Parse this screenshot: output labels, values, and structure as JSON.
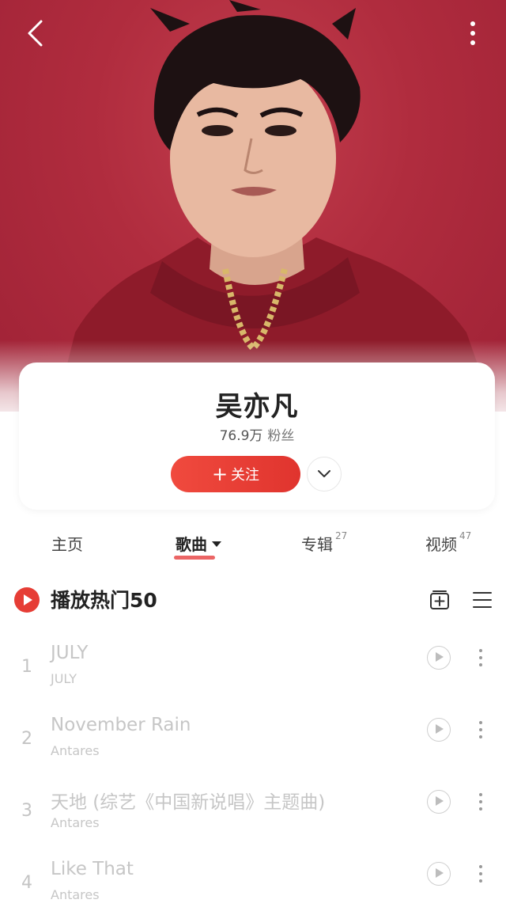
{
  "artist": {
    "name": "吴亦凡",
    "fans_count": "76.9万",
    "fans_label": "粉丝",
    "follow_label": "关注",
    "follow_plus": "+"
  },
  "tabs": [
    {
      "label": "主页",
      "count": ""
    },
    {
      "label": "歌曲",
      "count": ""
    },
    {
      "label": "专辑",
      "count": "27"
    },
    {
      "label": "视频",
      "count": "47"
    }
  ],
  "playall": {
    "label": "播放热门50"
  },
  "songs": [
    {
      "index": "1",
      "title": "JULY",
      "artist": "JULY"
    },
    {
      "index": "2",
      "title": "November Rain",
      "artist": "Antares"
    },
    {
      "index": "3",
      "title": "天地 (综艺《中国新说唱》主题曲)",
      "artist": "Antares"
    },
    {
      "index": "4",
      "title": "Like That",
      "artist": "Antares"
    }
  ],
  "colors": {
    "accent": "#e63d35",
    "hero_bg": "#b02c3e"
  },
  "icons": {
    "back": "chevron-left-icon",
    "more": "vertical-dots-icon",
    "expand": "chevron-down-icon",
    "play_all": "play-circle-icon",
    "add_collection": "add-to-collection-icon",
    "multi_select": "list-menu-icon",
    "song_play": "play-circle-outline-icon",
    "song_more": "vertical-dots-icon"
  }
}
